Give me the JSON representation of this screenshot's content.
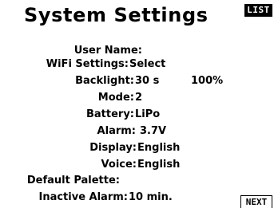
{
  "header": {
    "title": "System Settings",
    "list_label": "LIST"
  },
  "settings": {
    "user_name": {
      "label": "User Name:",
      "value": ""
    },
    "wifi": {
      "label": "WiFi Settings:",
      "value": "Select"
    },
    "backlight": {
      "label": "Backlight:",
      "value": "30 s",
      "extra": "100%"
    },
    "mode": {
      "label": "Mode:",
      "value": "2"
    },
    "battery": {
      "label": "Battery:",
      "value": "LiPo"
    },
    "alarm": {
      "label": "Alarm:",
      "value": "3.7V"
    },
    "display": {
      "label": "Display:",
      "value": "English"
    },
    "voice": {
      "label": "Voice:",
      "value": "English"
    },
    "default_palette": {
      "label": "Default Palette:",
      "value": ""
    },
    "inactive_alarm": {
      "label": "Inactive Alarm:",
      "value": "10 min."
    }
  },
  "footer": {
    "next_label": "NEXT"
  }
}
